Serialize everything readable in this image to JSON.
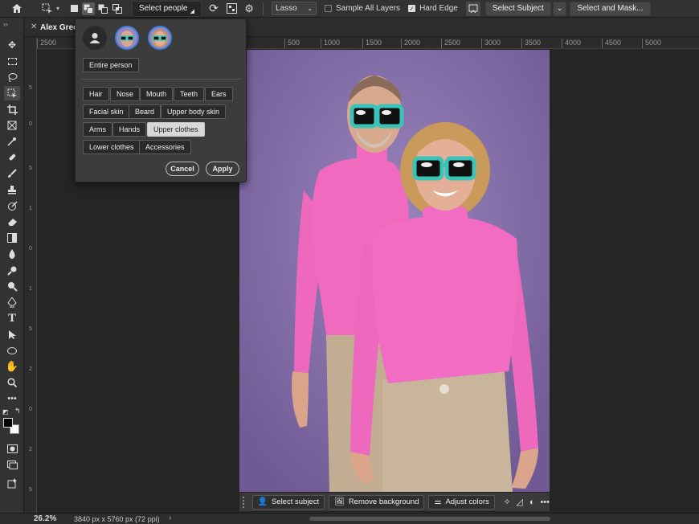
{
  "optionsbar": {
    "select_people": "Select people",
    "lasso": "Lasso",
    "sample_all_layers": "Sample All Layers",
    "hard_edge": "Hard Edge",
    "select_subject": "Select Subject",
    "select_and_mask": "Select and Mask..."
  },
  "document": {
    "tab_title": "Alex Gree"
  },
  "ruler": {
    "h_labels": [
      "2500",
      "500",
      "1000",
      "1500",
      "2000",
      "2500",
      "3000",
      "3500",
      "4000",
      "4500",
      "5000"
    ]
  },
  "popup": {
    "entire_person": "Entire person",
    "parts_row1": [
      "Hair",
      "Nose",
      "Mouth",
      "Teeth",
      "Ears"
    ],
    "parts_row2": [
      "Facial skin",
      "Beard",
      "Upper body skin"
    ],
    "parts_row3": [
      "Arms",
      "Hands",
      "Upper clothes"
    ],
    "parts_row4": [
      "Lower clothes",
      "Accessories"
    ],
    "selected_part": "Upper clothes",
    "cancel": "Cancel",
    "apply": "Apply"
  },
  "contextbar": {
    "select_subject": "Select subject",
    "remove_background": "Remove background",
    "adjust_colors": "Adjust colors"
  },
  "status": {
    "zoom": "26.2%",
    "doc_info": "3840 px x 5760 px (72 ppi)"
  },
  "colors": {
    "selection_overlay": "#f066bf",
    "backdrop": "#8a73ad",
    "sunglasses_frame": "#3ac4b8"
  }
}
